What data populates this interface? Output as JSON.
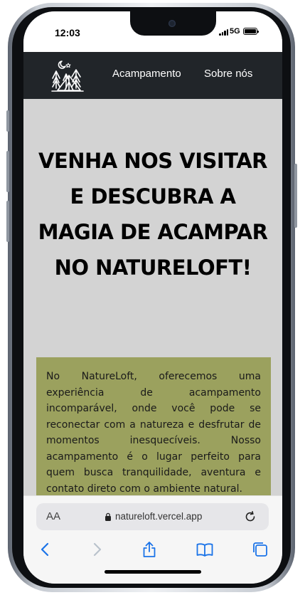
{
  "status_bar": {
    "time": "12:03",
    "network": "5G"
  },
  "navbar": {
    "logo_icon": "camping-tent-logo-icon",
    "links": [
      "Acampamento",
      "Sobre nós"
    ]
  },
  "hero": {
    "title": "VENHA NOS VISITAR E DESCUBRA A MAGIA DE ACAMPAR NO NATURELOFT!",
    "intro": "No NatureLoft, oferecemos uma experiência de acampamento incomparável, onde você pode se reconectar com a natureza e desfrutar de momentos inesquecíveis. Nosso acampamento é o lugar perfeito para quem busca tranquilidade, aventura e contato direto com o ambiente natural."
  },
  "browser": {
    "text_size_label": "AA",
    "url": "natureloft.vercel.app",
    "icons": [
      "lock-icon",
      "reload-icon",
      "back-icon",
      "forward-icon",
      "share-icon",
      "bookmarks-icon",
      "tabs-icon"
    ]
  },
  "colors": {
    "navbar_bg": "#212529",
    "page_bg": "#d3d3d3",
    "card_bg": "#9ba15e",
    "ios_blue": "#1a73e8"
  }
}
